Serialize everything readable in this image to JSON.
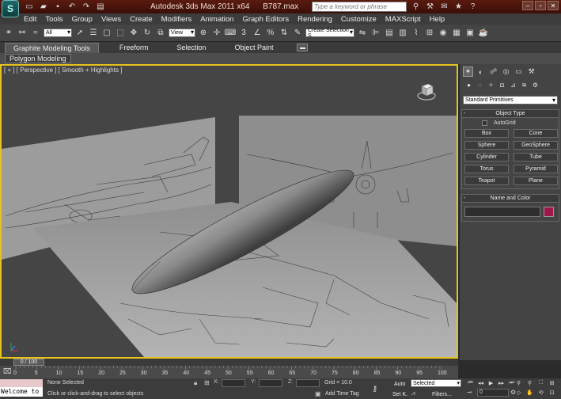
{
  "title": {
    "app": "Autodesk 3ds Max  2011 x64",
    "file": "B787.max",
    "search_placeholder": "Type a keyword or phrase"
  },
  "menu": [
    "Edit",
    "Tools",
    "Group",
    "Views",
    "Create",
    "Modifiers",
    "Animation",
    "Graph Editors",
    "Rendering",
    "Customize",
    "MAXScript",
    "Help"
  ],
  "toolbar": {
    "selection_filter": "All",
    "ref_coord": "View",
    "named_selection": "Create Selection S"
  },
  "ribbon": {
    "tabs": [
      "Graphite Modeling Tools",
      "Freeform",
      "Selection",
      "Object Paint"
    ],
    "active_tab": "Graphite Modeling Tools",
    "panel": "Polygon Modeling"
  },
  "viewport": {
    "label": "[ + ] [ Perspective ] [ Smooth + Highlights ]"
  },
  "command_panel": {
    "category": "Standard Primitives",
    "object_type_title": "Object Type",
    "autogrid": "AutoGrid",
    "buttons": [
      "Box",
      "Cone",
      "Sphere",
      "GeoSphere",
      "Cylinder",
      "Tube",
      "Torus",
      "Pyramid",
      "Teapot",
      "Plane"
    ],
    "name_color_title": "Name and Color",
    "swatch_color": "#a0164a"
  },
  "timeline": {
    "frame_display": "0 / 100",
    "ticks": [
      "0",
      "5",
      "10",
      "15",
      "20",
      "25",
      "30",
      "35",
      "40",
      "45",
      "50",
      "55",
      "60",
      "65",
      "70",
      "75",
      "80",
      "85",
      "90",
      "95",
      "100"
    ]
  },
  "status": {
    "welcome": "Welcome to",
    "selection": "None Selected",
    "prompt": "Click or click-and-drag to select objects",
    "x_label": "X:",
    "y_label": "Y:",
    "z_label": "Z:",
    "grid": "Grid = 10.0",
    "add_time_tag": "Add Time Tag",
    "auto": "Auto",
    "set_key": "Set K.",
    "selected": "Selected",
    "filters": "Filters...",
    "frame": "0"
  }
}
